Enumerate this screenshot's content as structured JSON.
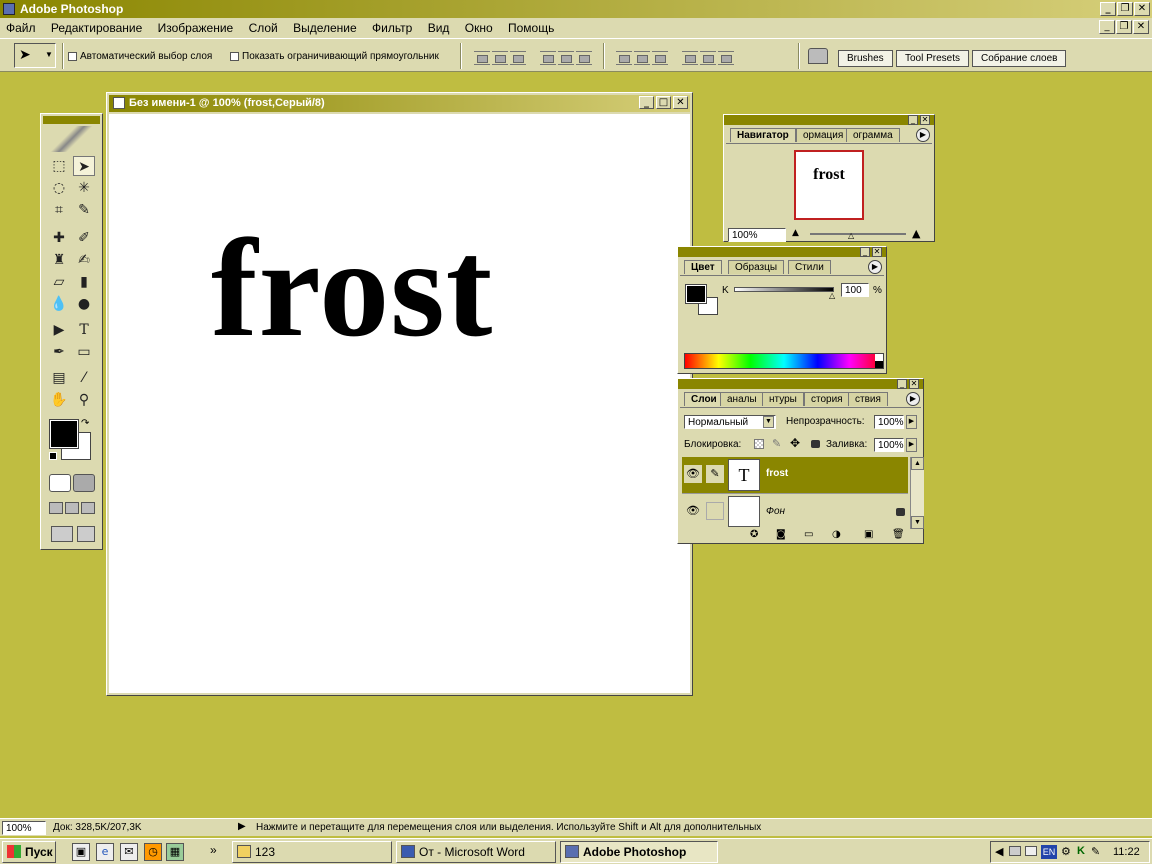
{
  "app": {
    "title": "Adobe Photoshop"
  },
  "menu": [
    "Файл",
    "Редактирование",
    "Изображение",
    "Слой",
    "Выделение",
    "Фильтр",
    "Вид",
    "Окно",
    "Помощь"
  ],
  "options": {
    "auto_select_label": "Автоматический выбор слоя",
    "show_bounds_label": "Показать ограничивающий прямоугольник"
  },
  "palette_well": {
    "tabs": [
      "Brushes",
      "Tool Presets",
      "Собрание слоев"
    ]
  },
  "document": {
    "title": "Без имени-1 @ 100% (frost,Серый/8)",
    "text": "frost"
  },
  "navigator": {
    "tabs": [
      "Навигатор",
      "ормация",
      "ограмма"
    ],
    "preview_text": "frost",
    "zoom": "100%"
  },
  "color": {
    "tabs": [
      "Цвет",
      "Образцы",
      "Стили"
    ],
    "channel_label": "K",
    "value": "100",
    "unit": "%"
  },
  "layers": {
    "tabs": [
      "Слои",
      "аналы",
      "нтуры",
      "стория",
      "ствия"
    ],
    "blend_mode": "Нормальный",
    "opacity_label": "Непрозрачность:",
    "opacity": "100%",
    "lock_label": "Блокировка:",
    "fill_label": "Заливка:",
    "fill": "100%",
    "items": [
      {
        "name": "frost",
        "thumb": "T"
      },
      {
        "name": "Фон",
        "thumb": ""
      }
    ]
  },
  "status": {
    "zoom": "100%",
    "doc": "Док: 328,5K/207,3K",
    "hint": "Нажмите и перетащите для перемещения слоя или выделения. Используйте Shift и Alt для дополнительных"
  },
  "taskbar": {
    "start": "Пуск",
    "tasks": [
      "123",
      "От - Microsoft Word",
      "Adobe Photoshop"
    ],
    "tray_lang": "EN",
    "clock": "11:22"
  },
  "colors": {
    "desktop": "#bfbd41",
    "accent": "#8a8600",
    "panel": "#dcdab0"
  }
}
